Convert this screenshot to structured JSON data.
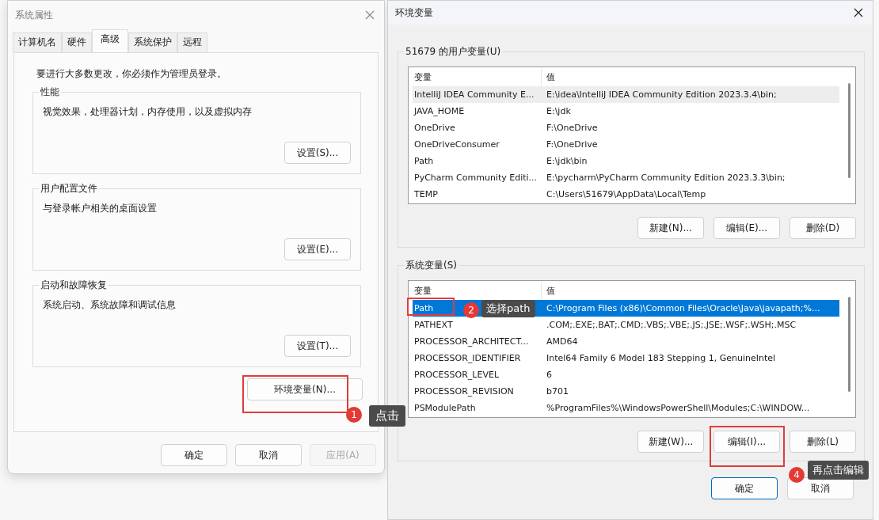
{
  "system_properties": {
    "title": "系统属性",
    "tabs": [
      {
        "label": "计算机名",
        "selected": false
      },
      {
        "label": "硬件",
        "selected": false
      },
      {
        "label": "高级",
        "selected": true
      },
      {
        "label": "系统保护",
        "selected": false
      },
      {
        "label": "远程",
        "selected": false
      }
    ],
    "notice": "要进行大多数更改，你必须作为管理员登录。",
    "groups": [
      {
        "title": "性能",
        "description": "视觉效果，处理器计划，内存使用，以及虚拟内存",
        "button": "设置(S)..."
      },
      {
        "title": "用户配置文件",
        "description": "与登录帐户相关的桌面设置",
        "button": "设置(E)..."
      },
      {
        "title": "启动和故障恢复",
        "description": "系统启动、系统故障和调试信息",
        "button": "设置(T)..."
      }
    ],
    "env_button": "环境变量(N)...",
    "buttons": [
      {
        "label": "确定",
        "disabled": false
      },
      {
        "label": "取消",
        "disabled": false
      },
      {
        "label": "应用(A)",
        "disabled": true
      }
    ]
  },
  "environment_variables": {
    "title": "环境变量",
    "lists": [
      {
        "title": "51679 的用户变量(U)",
        "focused": false,
        "columns": [
          "变量",
          "值"
        ],
        "rows": [
          {
            "name": "IntelliJ IDEA Community E...",
            "value": "E:\\idea\\IntelliJ IDEA Community Edition 2023.3.4\\bin;",
            "selected": true
          },
          {
            "name": "JAVA_HOME",
            "value": "E:\\jdk",
            "selected": false
          },
          {
            "name": "OneDrive",
            "value": "F:\\OneDrive",
            "selected": false
          },
          {
            "name": "OneDriveConsumer",
            "value": "F:\\OneDrive",
            "selected": false
          },
          {
            "name": "Path",
            "value": "E:\\jdk\\bin",
            "selected": false
          },
          {
            "name": "PyCharm Community Editi...",
            "value": "E:\\pycharm\\PyCharm Community Edition 2023.3.3\\bin;",
            "selected": false
          },
          {
            "name": "TEMP",
            "value": "C:\\Users\\51679\\AppData\\Local\\Temp",
            "selected": false
          }
        ],
        "buttons": [
          "新建(N)...",
          "编辑(E)...",
          "删除(D)"
        ]
      },
      {
        "title": "系统变量(S)",
        "focused": true,
        "columns": [
          "变量",
          "值"
        ],
        "rows": [
          {
            "name": "Path",
            "value": "C:\\Program Files (x86)\\Common Files\\Oracle\\Java\\javapath;%...",
            "selected": true
          },
          {
            "name": "PATHEXT",
            "value": ".COM;.EXE;.BAT;.CMD;.VBS;.VBE;.JS;.JSE;.WSF;.WSH;.MSC",
            "selected": false
          },
          {
            "name": "PROCESSOR_ARCHITECT...",
            "value": "AMD64",
            "selected": false
          },
          {
            "name": "PROCESSOR_IDENTIFIER",
            "value": "Intel64 Family 6 Model 183 Stepping 1, GenuineIntel",
            "selected": false
          },
          {
            "name": "PROCESSOR_LEVEL",
            "value": "6",
            "selected": false
          },
          {
            "name": "PROCESSOR_REVISION",
            "value": "b701",
            "selected": false
          },
          {
            "name": "PSModulePath",
            "value": "%ProgramFiles%\\WindowsPowerShell\\Modules;C:\\WINDOW...",
            "selected": false
          }
        ],
        "buttons": [
          "新建(W)...",
          "编辑(I)...",
          "删除(L)"
        ]
      }
    ],
    "buttons": [
      "确定",
      "取消"
    ]
  },
  "annotations": [
    {
      "number": "1",
      "text": "点击"
    },
    {
      "number": "2",
      "text": "选择path"
    },
    {
      "number": "4",
      "text": "再点击编辑"
    }
  ]
}
